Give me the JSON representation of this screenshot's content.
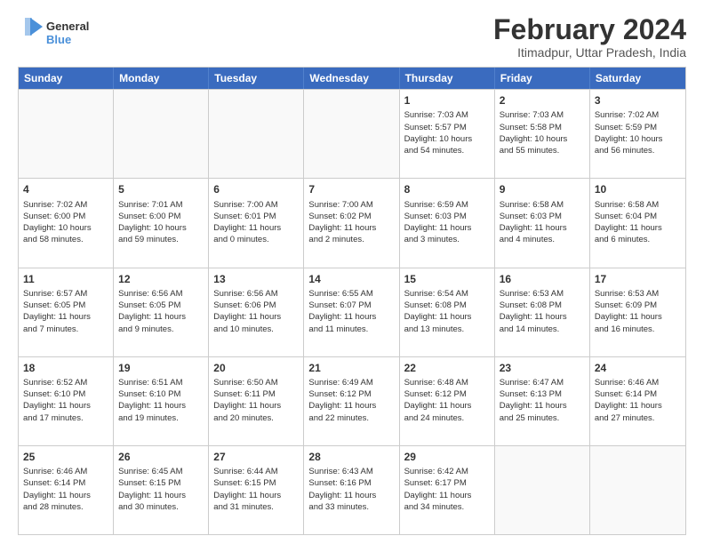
{
  "logo": {
    "line1": "General",
    "line2": "Blue"
  },
  "title": {
    "month_year": "February 2024",
    "location": "Itimadpur, Uttar Pradesh, India"
  },
  "header_days": [
    "Sunday",
    "Monday",
    "Tuesday",
    "Wednesday",
    "Thursday",
    "Friday",
    "Saturday"
  ],
  "weeks": [
    [
      {
        "day": "",
        "info": ""
      },
      {
        "day": "",
        "info": ""
      },
      {
        "day": "",
        "info": ""
      },
      {
        "day": "",
        "info": ""
      },
      {
        "day": "1",
        "info": "Sunrise: 7:03 AM\nSunset: 5:57 PM\nDaylight: 10 hours\nand 54 minutes."
      },
      {
        "day": "2",
        "info": "Sunrise: 7:03 AM\nSunset: 5:58 PM\nDaylight: 10 hours\nand 55 minutes."
      },
      {
        "day": "3",
        "info": "Sunrise: 7:02 AM\nSunset: 5:59 PM\nDaylight: 10 hours\nand 56 minutes."
      }
    ],
    [
      {
        "day": "4",
        "info": "Sunrise: 7:02 AM\nSunset: 6:00 PM\nDaylight: 10 hours\nand 58 minutes."
      },
      {
        "day": "5",
        "info": "Sunrise: 7:01 AM\nSunset: 6:00 PM\nDaylight: 10 hours\nand 59 minutes."
      },
      {
        "day": "6",
        "info": "Sunrise: 7:00 AM\nSunset: 6:01 PM\nDaylight: 11 hours\nand 0 minutes."
      },
      {
        "day": "7",
        "info": "Sunrise: 7:00 AM\nSunset: 6:02 PM\nDaylight: 11 hours\nand 2 minutes."
      },
      {
        "day": "8",
        "info": "Sunrise: 6:59 AM\nSunset: 6:03 PM\nDaylight: 11 hours\nand 3 minutes."
      },
      {
        "day": "9",
        "info": "Sunrise: 6:58 AM\nSunset: 6:03 PM\nDaylight: 11 hours\nand 4 minutes."
      },
      {
        "day": "10",
        "info": "Sunrise: 6:58 AM\nSunset: 6:04 PM\nDaylight: 11 hours\nand 6 minutes."
      }
    ],
    [
      {
        "day": "11",
        "info": "Sunrise: 6:57 AM\nSunset: 6:05 PM\nDaylight: 11 hours\nand 7 minutes."
      },
      {
        "day": "12",
        "info": "Sunrise: 6:56 AM\nSunset: 6:05 PM\nDaylight: 11 hours\nand 9 minutes."
      },
      {
        "day": "13",
        "info": "Sunrise: 6:56 AM\nSunset: 6:06 PM\nDaylight: 11 hours\nand 10 minutes."
      },
      {
        "day": "14",
        "info": "Sunrise: 6:55 AM\nSunset: 6:07 PM\nDaylight: 11 hours\nand 11 minutes."
      },
      {
        "day": "15",
        "info": "Sunrise: 6:54 AM\nSunset: 6:08 PM\nDaylight: 11 hours\nand 13 minutes."
      },
      {
        "day": "16",
        "info": "Sunrise: 6:53 AM\nSunset: 6:08 PM\nDaylight: 11 hours\nand 14 minutes."
      },
      {
        "day": "17",
        "info": "Sunrise: 6:53 AM\nSunset: 6:09 PM\nDaylight: 11 hours\nand 16 minutes."
      }
    ],
    [
      {
        "day": "18",
        "info": "Sunrise: 6:52 AM\nSunset: 6:10 PM\nDaylight: 11 hours\nand 17 minutes."
      },
      {
        "day": "19",
        "info": "Sunrise: 6:51 AM\nSunset: 6:10 PM\nDaylight: 11 hours\nand 19 minutes."
      },
      {
        "day": "20",
        "info": "Sunrise: 6:50 AM\nSunset: 6:11 PM\nDaylight: 11 hours\nand 20 minutes."
      },
      {
        "day": "21",
        "info": "Sunrise: 6:49 AM\nSunset: 6:12 PM\nDaylight: 11 hours\nand 22 minutes."
      },
      {
        "day": "22",
        "info": "Sunrise: 6:48 AM\nSunset: 6:12 PM\nDaylight: 11 hours\nand 24 minutes."
      },
      {
        "day": "23",
        "info": "Sunrise: 6:47 AM\nSunset: 6:13 PM\nDaylight: 11 hours\nand 25 minutes."
      },
      {
        "day": "24",
        "info": "Sunrise: 6:46 AM\nSunset: 6:14 PM\nDaylight: 11 hours\nand 27 minutes."
      }
    ],
    [
      {
        "day": "25",
        "info": "Sunrise: 6:46 AM\nSunset: 6:14 PM\nDaylight: 11 hours\nand 28 minutes."
      },
      {
        "day": "26",
        "info": "Sunrise: 6:45 AM\nSunset: 6:15 PM\nDaylight: 11 hours\nand 30 minutes."
      },
      {
        "day": "27",
        "info": "Sunrise: 6:44 AM\nSunset: 6:15 PM\nDaylight: 11 hours\nand 31 minutes."
      },
      {
        "day": "28",
        "info": "Sunrise: 6:43 AM\nSunset: 6:16 PM\nDaylight: 11 hours\nand 33 minutes."
      },
      {
        "day": "29",
        "info": "Sunrise: 6:42 AM\nSunset: 6:17 PM\nDaylight: 11 hours\nand 34 minutes."
      },
      {
        "day": "",
        "info": ""
      },
      {
        "day": "",
        "info": ""
      }
    ]
  ]
}
